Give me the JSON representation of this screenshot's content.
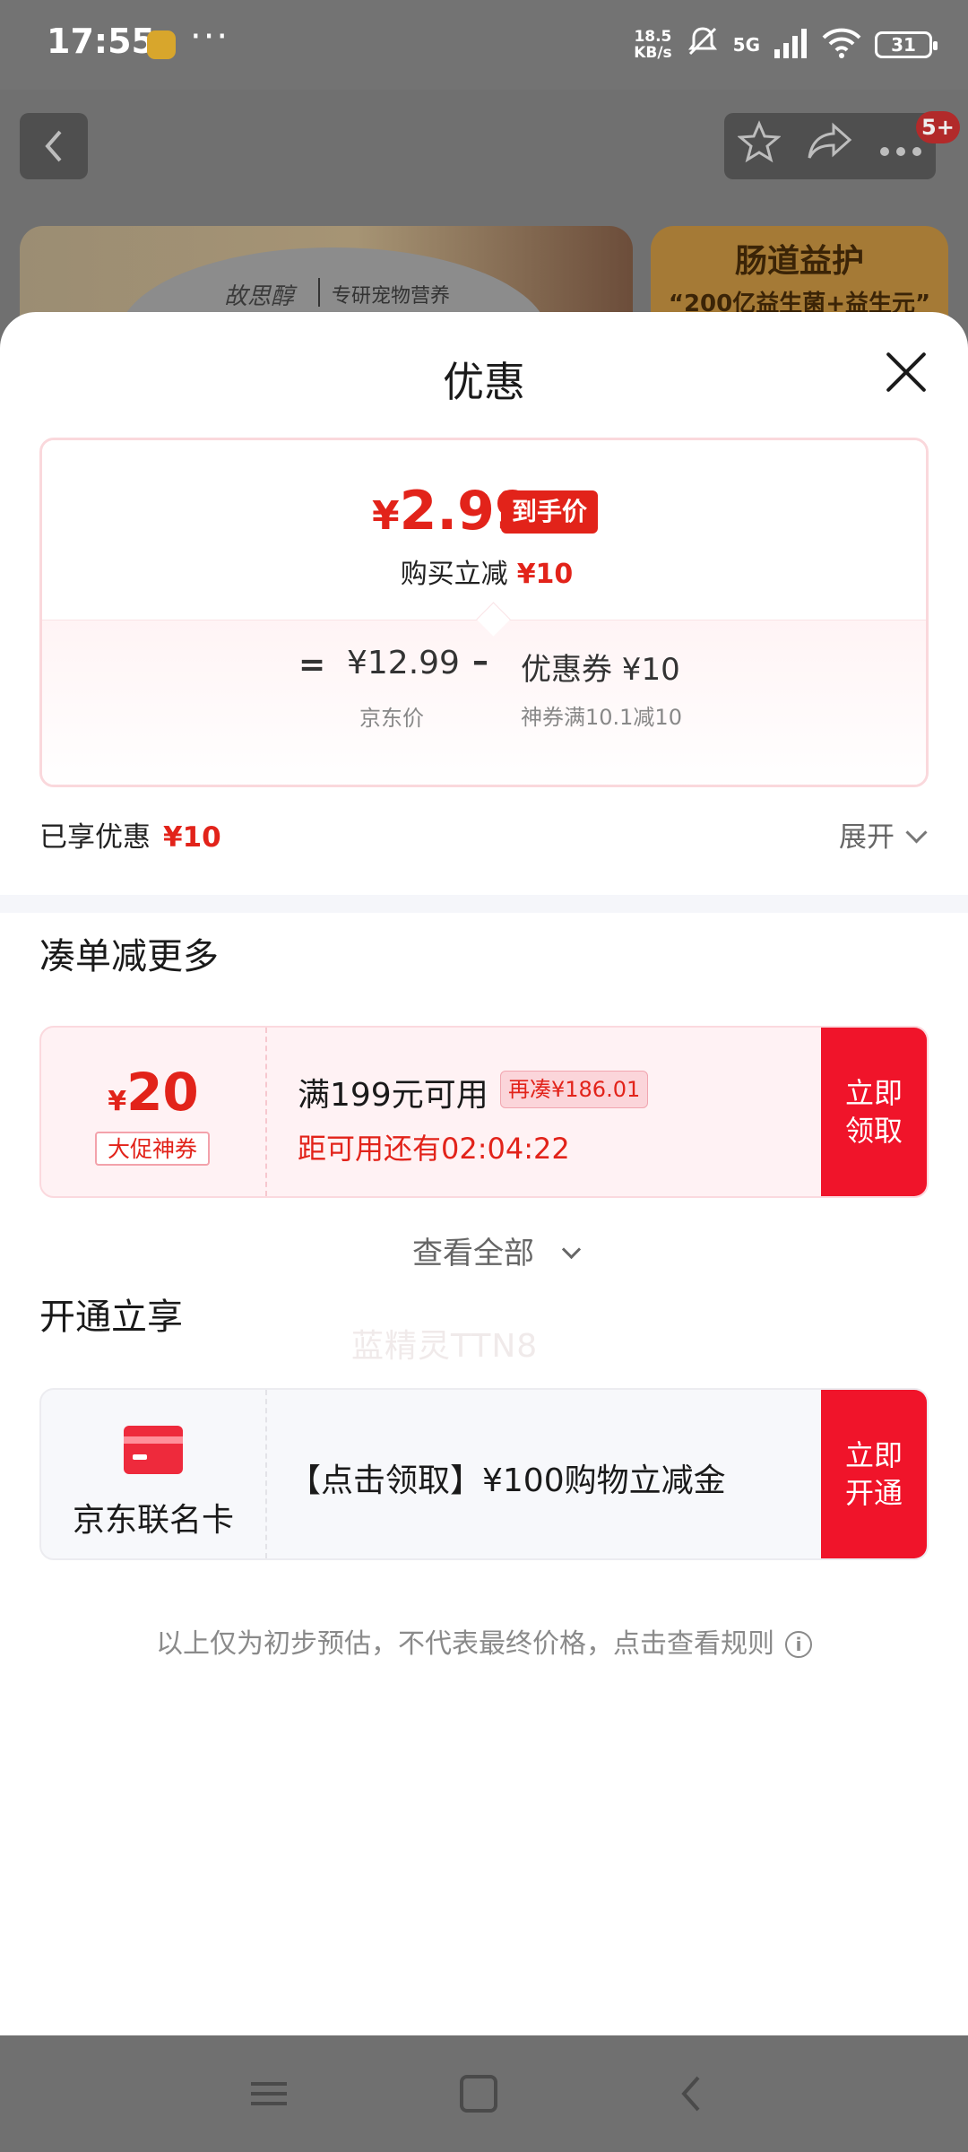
{
  "status_bar": {
    "time": "17:55",
    "more": "···",
    "net_speed_value": "18.5",
    "net_speed_unit": "KB/s",
    "network": "5G",
    "battery": "31"
  },
  "background_page": {
    "badge": "5+",
    "brand_logo": "故思醇",
    "brand_tagline": "专研宠物营养",
    "promo_title": "肠道益护",
    "promo_subtitle": "“200亿益生菌+益生元”"
  },
  "sheet": {
    "title": "优惠",
    "final_price": {
      "currency": "¥",
      "value": "2.99",
      "tag": "到手价"
    },
    "reduce": {
      "label": "购买立减",
      "amount": "¥10"
    },
    "formula": {
      "equals": "=",
      "jd_price": "¥12.99",
      "jd_price_label": "京东价",
      "minus": "–",
      "coupon": "优惠券 ¥10",
      "coupon_desc": "神券满10.1减10"
    },
    "enjoyed": {
      "label": "已享优惠",
      "amount": "¥10"
    },
    "expand_label": "展开",
    "combine_section": {
      "title": "凑单减更多",
      "watermark": "蓝精灵TTN8",
      "coupon": {
        "currency": "¥",
        "amount": "20",
        "tag": "大促神券",
        "threshold": "满199元可用",
        "need_more": "再凑¥186.01",
        "countdown": "距可用还有02:04:22",
        "button": "立即领取"
      },
      "view_all": "查看全部"
    },
    "open_section": {
      "title": "开通立享",
      "card_name": "京东联名卡",
      "offer": "【点击领取】¥100购物立减金",
      "button": "立即开通"
    },
    "disclaimer": "以上仅为初步预估，不代表最终价格，点击查看规则",
    "info_icon": "i"
  },
  "colors": {
    "accent_red": "#e2231a",
    "button_red": "#f0142a",
    "coupon_bg": "#fff2f4"
  },
  "icons": [
    "back-icon",
    "star-icon",
    "share-icon",
    "more-icon",
    "close-icon",
    "chevron-down-icon",
    "card-icon",
    "info-icon",
    "menu-nav-icon",
    "home-nav-icon",
    "back-nav-icon"
  ]
}
